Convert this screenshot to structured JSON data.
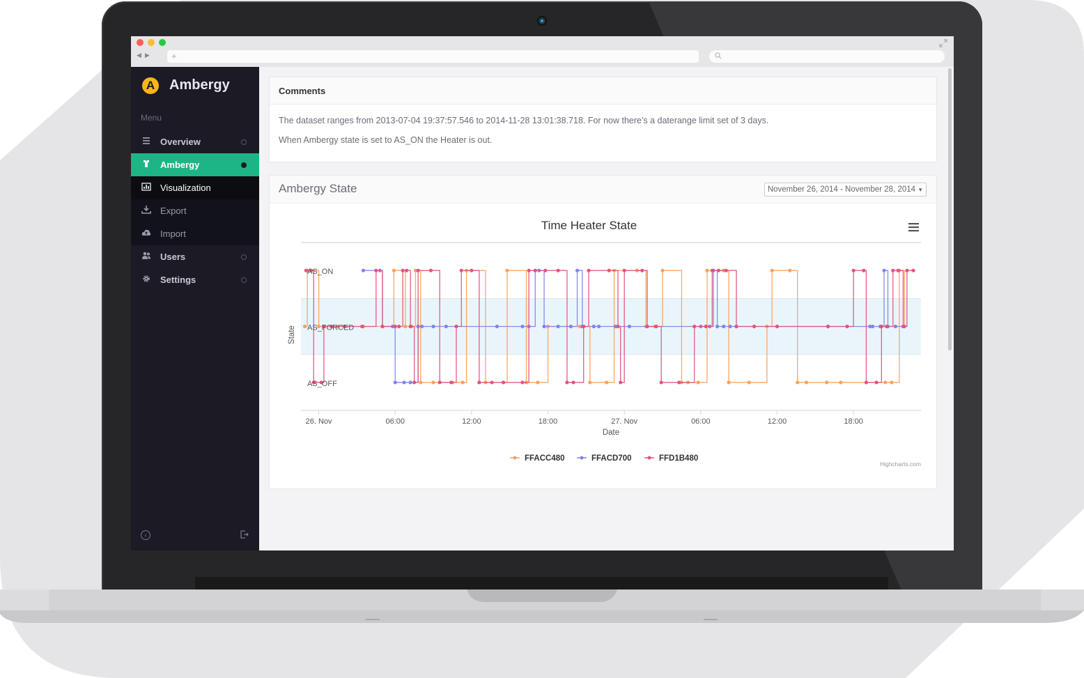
{
  "browser": {
    "url_placeholder": "+",
    "nav_back": "◀",
    "nav_forward": "▶"
  },
  "sidebar": {
    "brand_letter": "A",
    "brand_name": "Ambergy",
    "menu_label": "Menu",
    "items": [
      {
        "label": "Overview",
        "icon": "list-icon",
        "active": false,
        "sub": false,
        "has_ring": true
      },
      {
        "label": "Ambergy",
        "icon": "tshirt-icon",
        "active": true,
        "sub": false,
        "has_ring": true
      },
      {
        "label": "Visualization",
        "icon": "bar-chart-icon",
        "active": false,
        "sub": true,
        "selected": true,
        "has_ring": false
      },
      {
        "label": "Export",
        "icon": "download-icon",
        "active": false,
        "sub": true,
        "has_ring": false
      },
      {
        "label": "Import",
        "icon": "cloud-upload-icon",
        "active": false,
        "sub": true,
        "has_ring": false
      },
      {
        "label": "Users",
        "icon": "users-icon",
        "active": false,
        "sub": false,
        "has_ring": true
      },
      {
        "label": "Settings",
        "icon": "gear-icon",
        "active": false,
        "sub": false,
        "has_ring": true
      }
    ],
    "colors": {
      "bg": "#1b1a25",
      "active_bg": "#1db586",
      "selected_bg": "#0c0c11",
      "sub_bg": "#12121a"
    }
  },
  "comments": {
    "title": "Comments",
    "lines": [
      "The dataset ranges from 2013-07-04 19:37:57.546 to 2014-11-28 13:01:38.718. For now there's a daterange limit set of 3 days.",
      "When Ambergy state is set to AS_ON the Heater is out."
    ]
  },
  "state_panel": {
    "title": "Ambergy State",
    "date_range": "November 26, 2014 - November 28, 2014"
  },
  "chart_data": {
    "type": "line",
    "title": "Time Heater State",
    "xlabel": "Date",
    "ylabel": "State",
    "categories_y": [
      "AS_OFF",
      "AS_FORCED",
      "AS_ON"
    ],
    "y_tick_labels": [
      "AS_OFF",
      "AS_FORCED",
      "AS_ON"
    ],
    "x_tick_labels": [
      "26. Nov",
      "06:00",
      "12:00",
      "18:00",
      "27. Nov",
      "06:00",
      "12:00",
      "18:00"
    ],
    "x_tick_hours": [
      0,
      6,
      12,
      18,
      24,
      30,
      36,
      42
    ],
    "xlim_hours": [
      -1.4,
      47.3
    ],
    "ylim": [
      -0.5,
      2.5
    ],
    "plot_band": {
      "from": 0.5,
      "to": 1.5,
      "color": "#eaf5fb"
    },
    "step": true,
    "credits": "Highcharts.com",
    "legend_position": "bottom-center",
    "series": [
      {
        "name": "FFACC480",
        "color": "#f7a35c",
        "points": [
          [
            -1.1,
            1
          ],
          [
            -0.9,
            2
          ],
          [
            0.0,
            1
          ],
          [
            1.5,
            1
          ],
          [
            3.5,
            1
          ],
          [
            5.0,
            1
          ],
          [
            5.9,
            2
          ],
          [
            6.6,
            2
          ],
          [
            6.8,
            1
          ],
          [
            7.3,
            1
          ],
          [
            7.6,
            2
          ],
          [
            8.0,
            0
          ],
          [
            9.0,
            0
          ],
          [
            10.5,
            0
          ],
          [
            11.3,
            0
          ],
          [
            11.6,
            2
          ],
          [
            13.1,
            0
          ],
          [
            14.5,
            0
          ],
          [
            14.8,
            2
          ],
          [
            16.3,
            0
          ],
          [
            17.2,
            0
          ],
          [
            18.0,
            1
          ],
          [
            20.5,
            1
          ],
          [
            21.3,
            0
          ],
          [
            22.6,
            0
          ],
          [
            23.2,
            2
          ],
          [
            25.0,
            2
          ],
          [
            25.7,
            1
          ],
          [
            26.4,
            1
          ],
          [
            27.0,
            2
          ],
          [
            28.5,
            0
          ],
          [
            29.0,
            0
          ],
          [
            29.8,
            0
          ],
          [
            30.5,
            2
          ],
          [
            31.8,
            2
          ],
          [
            32.2,
            0
          ],
          [
            33.8,
            0
          ],
          [
            35.2,
            1
          ],
          [
            35.6,
            2
          ],
          [
            37.0,
            2
          ],
          [
            37.6,
            0
          ],
          [
            38.3,
            0
          ],
          [
            39.9,
            0
          ],
          [
            41.0,
            0
          ],
          [
            43.0,
            0
          ],
          [
            44.5,
            0
          ],
          [
            45.0,
            0
          ],
          [
            45.6,
            2
          ],
          [
            46.0,
            1
          ]
        ]
      },
      {
        "name": "FFACD700",
        "color": "#8085e9",
        "points": [
          [
            3.5,
            2
          ],
          [
            4.8,
            2
          ],
          [
            5.0,
            1
          ],
          [
            5.8,
            1
          ],
          [
            6.0,
            0
          ],
          [
            6.7,
            0
          ],
          [
            7.2,
            0
          ],
          [
            7.8,
            1
          ],
          [
            8.1,
            1
          ],
          [
            9.0,
            1
          ],
          [
            10.0,
            1
          ],
          [
            14.0,
            1
          ],
          [
            16.0,
            1
          ],
          [
            16.5,
            1
          ],
          [
            17.0,
            2
          ],
          [
            17.3,
            2
          ],
          [
            17.7,
            1
          ],
          [
            18.8,
            1
          ],
          [
            19.8,
            1
          ],
          [
            20.3,
            2
          ],
          [
            20.7,
            1
          ],
          [
            21.6,
            1
          ],
          [
            22.0,
            1
          ],
          [
            23.3,
            1
          ],
          [
            24.4,
            1
          ],
          [
            30.0,
            1
          ],
          [
            30.7,
            1
          ],
          [
            31.0,
            2
          ],
          [
            31.3,
            1
          ],
          [
            31.8,
            1
          ],
          [
            32.3,
            1
          ],
          [
            32.8,
            1
          ],
          [
            40.0,
            1
          ],
          [
            43.3,
            1
          ],
          [
            43.5,
            1
          ],
          [
            44.1,
            1
          ],
          [
            44.4,
            2
          ],
          [
            44.7,
            1
          ],
          [
            45.3,
            1
          ],
          [
            46.0,
            1
          ]
        ]
      },
      {
        "name": "FFD1B480",
        "color": "#e4537c",
        "points": [
          [
            -1.0,
            2
          ],
          [
            -0.6,
            2
          ],
          [
            -0.4,
            0
          ],
          [
            0.2,
            0
          ],
          [
            0.4,
            1
          ],
          [
            1.0,
            1
          ],
          [
            2.0,
            1
          ],
          [
            3.4,
            1
          ],
          [
            4.5,
            2
          ],
          [
            5.0,
            1
          ],
          [
            6.0,
            1
          ],
          [
            6.3,
            1
          ],
          [
            6.6,
            2
          ],
          [
            6.9,
            2
          ],
          [
            7.2,
            1
          ],
          [
            7.5,
            0
          ],
          [
            7.8,
            2
          ],
          [
            8.8,
            2
          ],
          [
            9.5,
            0
          ],
          [
            10.4,
            0
          ],
          [
            10.8,
            1
          ],
          [
            11.2,
            2
          ],
          [
            12.0,
            2
          ],
          [
            12.6,
            0
          ],
          [
            13.6,
            0
          ],
          [
            14.5,
            0
          ],
          [
            16.0,
            0
          ],
          [
            16.5,
            2
          ],
          [
            17.0,
            2
          ],
          [
            17.8,
            2
          ],
          [
            18.8,
            2
          ],
          [
            19.5,
            0
          ],
          [
            20.0,
            0
          ],
          [
            20.8,
            1
          ],
          [
            21.2,
            2
          ],
          [
            22.8,
            2
          ],
          [
            23.5,
            1
          ],
          [
            23.7,
            0
          ],
          [
            24.0,
            2
          ],
          [
            25.4,
            2
          ],
          [
            25.8,
            1
          ],
          [
            26.5,
            1
          ],
          [
            26.9,
            0
          ],
          [
            28.3,
            0
          ],
          [
            29.5,
            1
          ],
          [
            30.4,
            1
          ],
          [
            30.9,
            2
          ],
          [
            31.4,
            2
          ],
          [
            32.0,
            2
          ],
          [
            32.8,
            1
          ],
          [
            34.2,
            1
          ],
          [
            36.0,
            1
          ],
          [
            40.0,
            1
          ],
          [
            41.5,
            1
          ],
          [
            42.0,
            2
          ],
          [
            42.8,
            2
          ],
          [
            43.0,
            0
          ],
          [
            43.8,
            0
          ],
          [
            44.2,
            1
          ],
          [
            44.6,
            1
          ],
          [
            45.1,
            2
          ],
          [
            45.5,
            2
          ],
          [
            45.9,
            1
          ],
          [
            46.2,
            2
          ],
          [
            46.7,
            2
          ]
        ]
      }
    ]
  }
}
